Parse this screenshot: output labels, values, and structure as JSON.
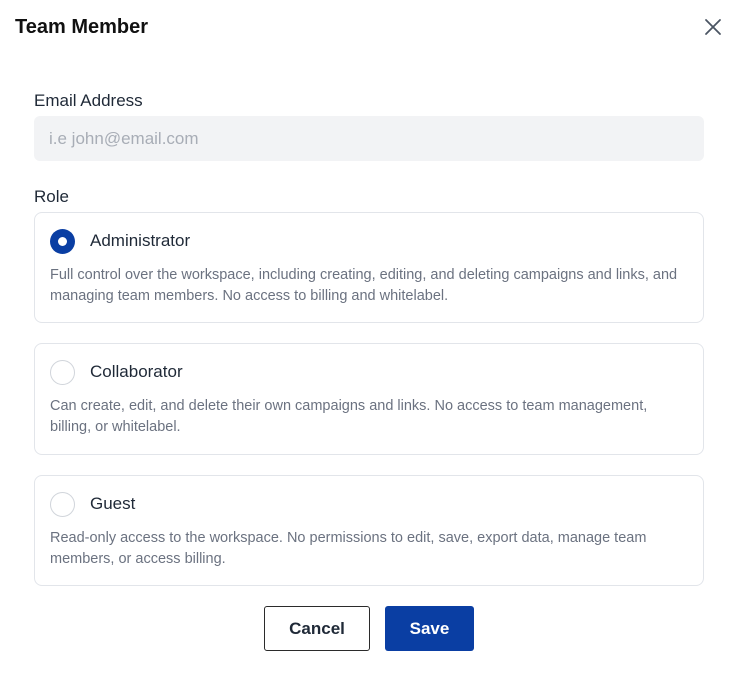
{
  "dialog": {
    "title": "Team Member"
  },
  "email": {
    "label": "Email Address",
    "value": "",
    "placeholder": "i.e john@email.com"
  },
  "role": {
    "label": "Role",
    "selected": "Administrator",
    "options": [
      {
        "name": "Administrator",
        "description": "Full control over the workspace, including creating, editing, and deleting campaigns and links, and managing team members. No access to billing and whitelabel.",
        "checked": true
      },
      {
        "name": "Collaborator",
        "description": "Can create, edit, and delete their own campaigns and links. No access to team management, billing, or whitelabel.",
        "checked": false
      },
      {
        "name": "Guest",
        "description": "Read-only access to the workspace. No permissions to edit, save, export data, manage team members, or access billing.",
        "checked": false
      }
    ]
  },
  "actions": {
    "cancel_label": "Cancel",
    "save_label": "Save"
  },
  "colors": {
    "accent": "#0a3ea3",
    "input_bg": "#f2f3f5",
    "muted_text": "#6b7280"
  },
  "icons": {
    "close": "close-icon"
  }
}
